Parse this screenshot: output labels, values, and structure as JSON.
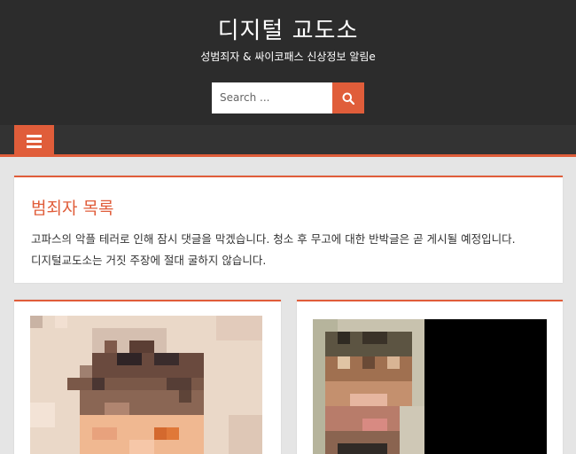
{
  "header": {
    "site_title": "디지털 교도소",
    "site_description": "성범죄자 & 싸이코패스 신상정보 알림e"
  },
  "search": {
    "placeholder": "Search ..."
  },
  "nav": {
    "menu_icon": "hamburger-menu-icon"
  },
  "main": {
    "title": "범죄자 목록",
    "notice_line1": "고파스의 악플 테러로 인해 잠시 댓글을 막겠습니다. 청소 후 무고에 대한 반박글은 곧 게시될 예정입니다.",
    "notice_line2": "디지털교도소는 거짓 주장에 절대 굴하지 않습니다."
  },
  "colors": {
    "accent": "#e05d3a",
    "header_bg": "#2c2c2c",
    "nav_bg": "#333333",
    "page_bg": "#e5e5e5"
  }
}
